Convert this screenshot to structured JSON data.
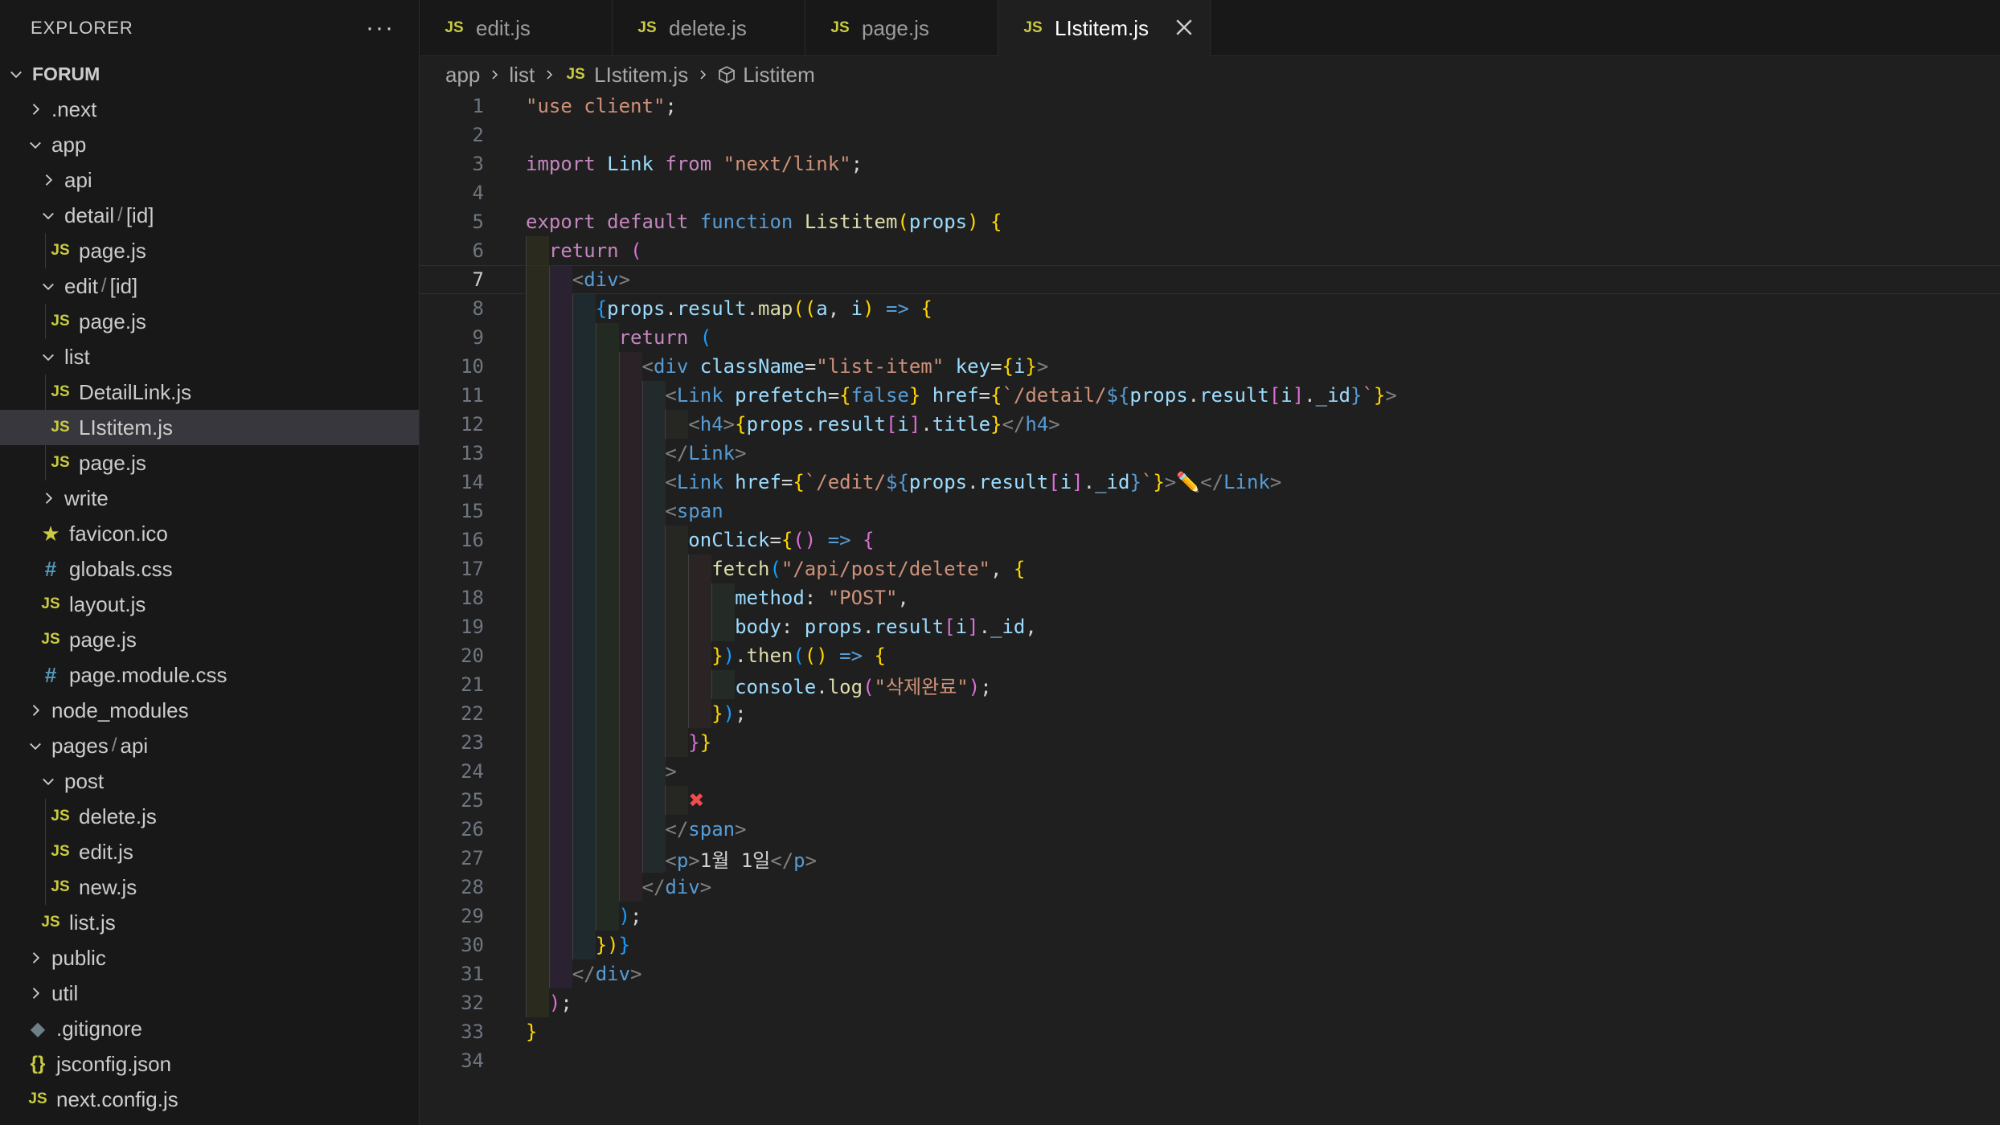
{
  "sidebar": {
    "title": "EXPLORER",
    "more": "···",
    "tree": [
      {
        "label": "FORUM",
        "depth": 0,
        "type": "root",
        "chevron": "down"
      },
      {
        "label": ".next",
        "depth": 1,
        "type": "folder",
        "chevron": "right"
      },
      {
        "label": "app",
        "depth": 1,
        "type": "folder",
        "chevron": "down"
      },
      {
        "label": "api",
        "depth": 2,
        "type": "folder",
        "chevron": "right"
      },
      {
        "label": "detail",
        "label2": "[id]",
        "depth": 2,
        "type": "folder",
        "chevron": "down"
      },
      {
        "label": "page.js",
        "depth": 3,
        "type": "js"
      },
      {
        "label": "edit",
        "label2": "[id]",
        "depth": 2,
        "type": "folder",
        "chevron": "down"
      },
      {
        "label": "page.js",
        "depth": 3,
        "type": "js"
      },
      {
        "label": "list",
        "depth": 2,
        "type": "folder",
        "chevron": "down"
      },
      {
        "label": "DetailLink.js",
        "depth": 3,
        "type": "js"
      },
      {
        "label": "LIstitem.js",
        "depth": 3,
        "type": "js",
        "selected": true
      },
      {
        "label": "page.js",
        "depth": 3,
        "type": "js"
      },
      {
        "label": "write",
        "depth": 2,
        "type": "folder",
        "chevron": "right"
      },
      {
        "label": "favicon.ico",
        "depth": 2,
        "type": "star"
      },
      {
        "label": "globals.css",
        "depth": 2,
        "type": "css"
      },
      {
        "label": "layout.js",
        "depth": 2,
        "type": "js"
      },
      {
        "label": "page.js",
        "depth": 2,
        "type": "js"
      },
      {
        "label": "page.module.css",
        "depth": 2,
        "type": "css"
      },
      {
        "label": "node_modules",
        "depth": 1,
        "type": "folder",
        "chevron": "right"
      },
      {
        "label": "pages",
        "label2": "api",
        "depth": 1,
        "type": "folder",
        "chevron": "down"
      },
      {
        "label": "post",
        "depth": 2,
        "type": "folder",
        "chevron": "down"
      },
      {
        "label": "delete.js",
        "depth": 3,
        "type": "js"
      },
      {
        "label": "edit.js",
        "depth": 3,
        "type": "js"
      },
      {
        "label": "new.js",
        "depth": 3,
        "type": "js"
      },
      {
        "label": "list.js",
        "depth": 2,
        "type": "js"
      },
      {
        "label": "public",
        "depth": 1,
        "type": "folder",
        "chevron": "right"
      },
      {
        "label": "util",
        "depth": 1,
        "type": "folder",
        "chevron": "right"
      },
      {
        "label": ".gitignore",
        "depth": 1,
        "type": "git"
      },
      {
        "label": "jsconfig.json",
        "depth": 1,
        "type": "json"
      },
      {
        "label": "next.config.js",
        "depth": 1,
        "type": "js"
      }
    ],
    "icons": {
      "js": "JS",
      "css": "#",
      "star": "★",
      "json": "{}",
      "git": "◆"
    }
  },
  "tabs": [
    {
      "label": "edit.js",
      "icon": "JS",
      "active": false
    },
    {
      "label": "delete.js",
      "icon": "JS",
      "active": false
    },
    {
      "label": "page.js",
      "icon": "JS",
      "active": false
    },
    {
      "label": "LIstitem.js",
      "icon": "JS",
      "active": true
    }
  ],
  "breadcrumb": {
    "parts": [
      "app",
      "list"
    ],
    "file_icon": "JS",
    "file": "LIstitem.js",
    "symbol": "Listitem"
  },
  "editor": {
    "current_line": 7,
    "lines": [
      [
        [
          "str",
          "\"use client\""
        ],
        [
          "txt",
          ";"
        ]
      ],
      [],
      [
        [
          "kw",
          "import"
        ],
        [
          "txt",
          " "
        ],
        [
          "var",
          "Link"
        ],
        [
          "txt",
          " "
        ],
        [
          "kw",
          "from"
        ],
        [
          "txt",
          " "
        ],
        [
          "str",
          "\"next/link\""
        ],
        [
          "txt",
          ";"
        ]
      ],
      [],
      [
        [
          "kw",
          "export"
        ],
        [
          "txt",
          " "
        ],
        [
          "kw",
          "default"
        ],
        [
          "txt",
          " "
        ],
        [
          "kb",
          "function"
        ],
        [
          "txt",
          " "
        ],
        [
          "fn",
          "Listitem"
        ],
        [
          "b1",
          "("
        ],
        [
          "var",
          "props"
        ],
        [
          "b1",
          ")"
        ],
        [
          "txt",
          " "
        ],
        [
          "b1",
          "{"
        ]
      ],
      [
        [
          "ws",
          "  "
        ],
        [
          "kw",
          "return"
        ],
        [
          "txt",
          " "
        ],
        [
          "b2",
          "("
        ]
      ],
      [
        [
          "ws",
          "    "
        ],
        [
          "pun",
          "<"
        ],
        [
          "tag",
          "div"
        ],
        [
          "pun",
          ">"
        ]
      ],
      [
        [
          "ws",
          "      "
        ],
        [
          "b3",
          "{"
        ],
        [
          "var",
          "props"
        ],
        [
          "txt",
          "."
        ],
        [
          "var",
          "result"
        ],
        [
          "txt",
          "."
        ],
        [
          "fn",
          "map"
        ],
        [
          "b1",
          "(("
        ],
        [
          "var",
          "a"
        ],
        [
          "txt",
          ", "
        ],
        [
          "var",
          "i"
        ],
        [
          "b1",
          ")"
        ],
        [
          "txt",
          " "
        ],
        [
          "kb",
          "=>"
        ],
        [
          "txt",
          " "
        ],
        [
          "b1",
          "{"
        ]
      ],
      [
        [
          "ws",
          "        "
        ],
        [
          "kw",
          "return"
        ],
        [
          "txt",
          " "
        ],
        [
          "b3",
          "("
        ]
      ],
      [
        [
          "ws",
          "          "
        ],
        [
          "pun",
          "<"
        ],
        [
          "tag",
          "div"
        ],
        [
          "txt",
          " "
        ],
        [
          "var",
          "className"
        ],
        [
          "txt",
          "="
        ],
        [
          "str",
          "\"list-item\""
        ],
        [
          "txt",
          " "
        ],
        [
          "var",
          "key"
        ],
        [
          "txt",
          "="
        ],
        [
          "b1",
          "{"
        ],
        [
          "var",
          "i"
        ],
        [
          "b1",
          "}"
        ],
        [
          "pun",
          ">"
        ]
      ],
      [
        [
          "ws",
          "            "
        ],
        [
          "pun",
          "<"
        ],
        [
          "tag",
          "Link"
        ],
        [
          "txt",
          " "
        ],
        [
          "var",
          "prefetch"
        ],
        [
          "txt",
          "="
        ],
        [
          "b1",
          "{"
        ],
        [
          "kb",
          "false"
        ],
        [
          "b1",
          "}"
        ],
        [
          "txt",
          " "
        ],
        [
          "var",
          "href"
        ],
        [
          "txt",
          "="
        ],
        [
          "b1",
          "{"
        ],
        [
          "str",
          "`/detail/"
        ],
        [
          "kb",
          "${"
        ],
        [
          "var",
          "props"
        ],
        [
          "txt",
          "."
        ],
        [
          "var",
          "result"
        ],
        [
          "b2",
          "["
        ],
        [
          "var",
          "i"
        ],
        [
          "b2",
          "]"
        ],
        [
          "txt",
          "."
        ],
        [
          "var",
          "_id"
        ],
        [
          "kb",
          "}"
        ],
        [
          "str",
          "`"
        ],
        [
          "b1",
          "}"
        ],
        [
          "pun",
          ">"
        ]
      ],
      [
        [
          "ws",
          "              "
        ],
        [
          "pun",
          "<"
        ],
        [
          "tag",
          "h4"
        ],
        [
          "pun",
          ">"
        ],
        [
          "b1",
          "{"
        ],
        [
          "var",
          "props"
        ],
        [
          "txt",
          "."
        ],
        [
          "var",
          "result"
        ],
        [
          "b2",
          "["
        ],
        [
          "var",
          "i"
        ],
        [
          "b2",
          "]"
        ],
        [
          "txt",
          "."
        ],
        [
          "var",
          "title"
        ],
        [
          "b1",
          "}"
        ],
        [
          "pun",
          "</"
        ],
        [
          "tag",
          "h4"
        ],
        [
          "pun",
          ">"
        ]
      ],
      [
        [
          "ws",
          "            "
        ],
        [
          "pun",
          "</"
        ],
        [
          "tag",
          "Link"
        ],
        [
          "pun",
          ">"
        ]
      ],
      [
        [
          "ws",
          "            "
        ],
        [
          "pun",
          "<"
        ],
        [
          "tag",
          "Link"
        ],
        [
          "txt",
          " "
        ],
        [
          "var",
          "href"
        ],
        [
          "txt",
          "="
        ],
        [
          "b1",
          "{"
        ],
        [
          "str",
          "`/edit/"
        ],
        [
          "kb",
          "${"
        ],
        [
          "var",
          "props"
        ],
        [
          "txt",
          "."
        ],
        [
          "var",
          "result"
        ],
        [
          "b2",
          "["
        ],
        [
          "var",
          "i"
        ],
        [
          "b2",
          "]"
        ],
        [
          "txt",
          "."
        ],
        [
          "var",
          "_id"
        ],
        [
          "kb",
          "}"
        ],
        [
          "str",
          "`"
        ],
        [
          "b1",
          "}"
        ],
        [
          "pun",
          ">"
        ],
        [
          "txt",
          "✏️"
        ],
        [
          "pun",
          "</"
        ],
        [
          "tag",
          "Link"
        ],
        [
          "pun",
          ">"
        ]
      ],
      [
        [
          "ws",
          "            "
        ],
        [
          "pun",
          "<"
        ],
        [
          "tag",
          "span"
        ]
      ],
      [
        [
          "ws",
          "              "
        ],
        [
          "var",
          "onClick"
        ],
        [
          "txt",
          "="
        ],
        [
          "b1",
          "{"
        ],
        [
          "b2",
          "()"
        ],
        [
          "txt",
          " "
        ],
        [
          "kb",
          "=>"
        ],
        [
          "txt",
          " "
        ],
        [
          "b2",
          "{"
        ]
      ],
      [
        [
          "ws",
          "                "
        ],
        [
          "fn",
          "fetch"
        ],
        [
          "b3",
          "("
        ],
        [
          "str",
          "\"/api/post/delete\""
        ],
        [
          "txt",
          ", "
        ],
        [
          "b1",
          "{"
        ]
      ],
      [
        [
          "ws",
          "                  "
        ],
        [
          "var",
          "method"
        ],
        [
          "txt",
          ": "
        ],
        [
          "str",
          "\"POST\""
        ],
        [
          "txt",
          ","
        ]
      ],
      [
        [
          "ws",
          "                  "
        ],
        [
          "var",
          "body"
        ],
        [
          "txt",
          ": "
        ],
        [
          "var",
          "props"
        ],
        [
          "txt",
          "."
        ],
        [
          "var",
          "result"
        ],
        [
          "b2",
          "["
        ],
        [
          "var",
          "i"
        ],
        [
          "b2",
          "]"
        ],
        [
          "txt",
          "."
        ],
        [
          "var",
          "_id"
        ],
        [
          "txt",
          ","
        ]
      ],
      [
        [
          "ws",
          "                "
        ],
        [
          "b1",
          "}"
        ],
        [
          "b3",
          ")"
        ],
        [
          "txt",
          "."
        ],
        [
          "fn",
          "then"
        ],
        [
          "b3",
          "("
        ],
        [
          "b1",
          "()"
        ],
        [
          "txt",
          " "
        ],
        [
          "kb",
          "=>"
        ],
        [
          "txt",
          " "
        ],
        [
          "b1",
          "{"
        ]
      ],
      [
        [
          "ws",
          "                  "
        ],
        [
          "var",
          "console"
        ],
        [
          "txt",
          "."
        ],
        [
          "fn",
          "log"
        ],
        [
          "b2",
          "("
        ],
        [
          "str",
          "\"삭제완료\""
        ],
        [
          "b2",
          ")"
        ],
        [
          "txt",
          ";"
        ]
      ],
      [
        [
          "ws",
          "                "
        ],
        [
          "b1",
          "}"
        ],
        [
          "b3",
          ")"
        ],
        [
          "txt",
          ";"
        ]
      ],
      [
        [
          "ws",
          "              "
        ],
        [
          "b2",
          "}"
        ],
        [
          "b1",
          "}"
        ]
      ],
      [
        [
          "ws",
          "            "
        ],
        [
          "pun",
          ">"
        ]
      ],
      [
        [
          "ws",
          "              "
        ],
        [
          "x",
          "✖"
        ]
      ],
      [
        [
          "ws",
          "            "
        ],
        [
          "pun",
          "</"
        ],
        [
          "tag",
          "span"
        ],
        [
          "pun",
          ">"
        ]
      ],
      [
        [
          "ws",
          "            "
        ],
        [
          "pun",
          "<"
        ],
        [
          "tag",
          "p"
        ],
        [
          "pun",
          ">"
        ],
        [
          "txt",
          "1월 1일"
        ],
        [
          "pun",
          "</"
        ],
        [
          "tag",
          "p"
        ],
        [
          "pun",
          ">"
        ]
      ],
      [
        [
          "ws",
          "          "
        ],
        [
          "pun",
          "</"
        ],
        [
          "tag",
          "div"
        ],
        [
          "pun",
          ">"
        ]
      ],
      [
        [
          "ws",
          "        "
        ],
        [
          "b3",
          ")"
        ],
        [
          "txt",
          ";"
        ]
      ],
      [
        [
          "ws",
          "      "
        ],
        [
          "b1",
          "})"
        ],
        [
          "b3",
          "}"
        ]
      ],
      [
        [
          "ws",
          "    "
        ],
        [
          "pun",
          "</"
        ],
        [
          "tag",
          "div"
        ],
        [
          "pun",
          ">"
        ]
      ],
      [
        [
          "ws",
          "  "
        ],
        [
          "b2",
          ")"
        ],
        [
          "txt",
          ";"
        ]
      ],
      [
        [
          "b1",
          "}"
        ]
      ],
      []
    ]
  },
  "colors": {
    "js": "#cbcb41",
    "css": "#519aba",
    "keyword": "#c586c0",
    "string": "#ce9178",
    "variable": "#9cdcfe",
    "tag": "#569cd6",
    "function": "#dcdcaa"
  }
}
